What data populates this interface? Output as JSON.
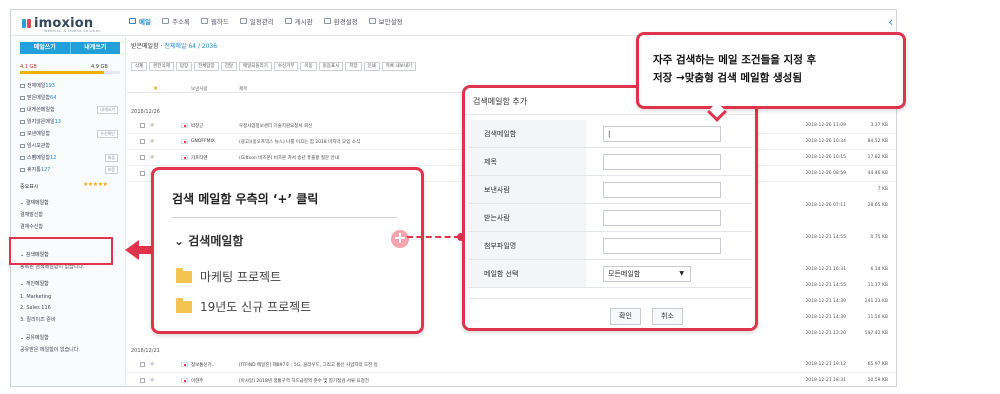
{
  "app": {
    "logo": "imoxion",
    "logo_sub": "Webmail & Mobile Solution"
  },
  "top_nav": {
    "items": [
      {
        "label": "메일"
      },
      {
        "label": "주소록"
      },
      {
        "label": "웹하드"
      },
      {
        "label": "일정관리"
      },
      {
        "label": "게시판"
      },
      {
        "label": "환경설정"
      },
      {
        "label": "보안설정"
      }
    ]
  },
  "sidebar": {
    "write_button": "메일쓰기",
    "self_write_button": "내게쓰기",
    "quota_used": "4.1 GB",
    "quota_total": "4.9 GB",
    "quota_fraction": 0.84,
    "items": [
      {
        "label": "전체메일",
        "count": "193"
      },
      {
        "label": "받은메일함",
        "count": "64"
      },
      {
        "label": "내게쓴메일함",
        "count": ""
      },
      {
        "label": "읽지않은메일",
        "count": "13"
      },
      {
        "label": "보낸메일함",
        "count": ""
      },
      {
        "label": "임시보관함",
        "count": ""
      },
      {
        "label": "스팸메일함",
        "count": "12"
      },
      {
        "label": "휴지통",
        "count": "127"
      }
    ],
    "chips": [
      "내게쓰기",
      "수신확인",
      "비움",
      "비움"
    ],
    "important_label": "중요표시",
    "approval_header": "결재메일함",
    "approval_items": [
      "결재발신함",
      "결재수신함"
    ],
    "search_header": "검색메일함",
    "search_empty": "등록된 검색메일함이 없습니다.",
    "personal_header": "개인메일함",
    "personal_items": [
      "1. Marketing",
      "2. Sales 116",
      "3. 릴리이즈 준비"
    ],
    "shared_header": "공유메일함",
    "shared_empty": "공유받은 메일함이 없습니다."
  },
  "main": {
    "title": "받은메일함",
    "title_count": "전체메일 64 / 2036",
    "toolbar": [
      "삭제",
      "완전삭제",
      "답장",
      "전체답장",
      "전달",
      "메일되돌리기",
      "수신거부",
      "이동",
      "읽음표시",
      "저장",
      "인쇄",
      "목록 내보내기"
    ],
    "header_sender": "보낸사람",
    "header_subject": "제목",
    "group_dates": [
      "2018/12/26",
      "2018/12/21"
    ],
    "rows": [
      {
        "sender": "박창근",
        "subject": "우정사업정보센터 기술지원요청서 회신",
        "date": "2018-12-26 11:09",
        "size": "3.37 KB"
      },
      {
        "sender": "GNOFFMIX",
        "subject": "(광고)(옹오프믹스 뉴스) 나를 이끄는 힘 2018 마지막 모임 소식",
        "date": "2018-12-26 10:34",
        "size": "84.52 KB"
      },
      {
        "sender": "기프티엔",
        "subject": "(Giftson 비즈몬) 비즈몬 카서 송년 퓨플팡 질문 안내",
        "date": "2018-12-26 10:15",
        "size": "17.82 KB"
      },
      {
        "sender": "Google",
        "subject": "품목부 외 Apple iPhone",
        "date": "2018-12-26 08:59",
        "size": "44.46 KB"
      },
      {
        "sender": "정보통신기..",
        "subject": "[ITFIND 메일진] 제897호 : 5G, 클라우드, 그리고 통신 사업자의 도전 등",
        "date": "2018-12-21 19:12",
        "size": "65.97 KB"
      },
      {
        "sender": "이현주",
        "subject": "[아사달] 2018년 정통구역 하드급정역 준수 및 정기점검 서류 요청건",
        "date": "2018-12-21 18:31",
        "size": "50.59 KB"
      }
    ],
    "right_dates": [
      "2018-12-26 07:11",
      "2018-12-21 14:55",
      "2018-12-21 16:31",
      "2018-12-21 14:55",
      "2018-12-21 14:39",
      "2018-12-21 14:39",
      "2018-12-21 13:20"
    ],
    "right_sizes": [
      "7 KB",
      "28.65 KB",
      "0.75 KB",
      "6.14 KB",
      "11.17 KB",
      "241.23 KB",
      "11.56 KB",
      "597.42 KB"
    ]
  },
  "callout_left": {
    "title": "검색 메일함 우측의 ‘+’ 클릭",
    "header": "검색메일함",
    "plus": "+",
    "folders": [
      "마케팅 프로젝트",
      "19년도 신규 프로젝트"
    ]
  },
  "callout_right": {
    "title": "검색메일함 추가",
    "fields": [
      {
        "label": "검색메일함",
        "value": "|"
      },
      {
        "label": "제목",
        "value": ""
      },
      {
        "label": "보낸사람",
        "value": ""
      },
      {
        "label": "받는사람",
        "value": ""
      },
      {
        "label": "첨부파일명",
        "value": ""
      },
      {
        "label": "메일함 선택",
        "value": "모든메일함"
      }
    ],
    "confirm": "확인",
    "cancel": "취소"
  },
  "callout_top": {
    "line1": "자주 검색하는 메일 조건들을  지정 후",
    "line2": "저장 →맞춤형 검색 메일함 생성됨"
  },
  "colors": {
    "accent": "#1e88d6",
    "highlight": "#e0334c",
    "button": "#22a0d9"
  }
}
